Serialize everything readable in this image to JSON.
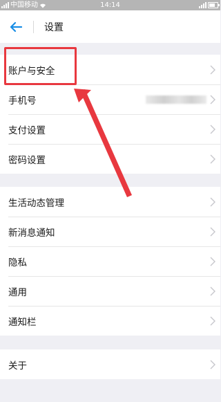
{
  "status_bar": {
    "carrier": "中国移动",
    "time": "14:14"
  },
  "header": {
    "title": "设置",
    "back_icon": "back-arrow-icon"
  },
  "groups": [
    {
      "items": [
        {
          "label": "账户与安全"
        },
        {
          "label": "手机号",
          "value_redacted": true
        },
        {
          "label": "支付设置"
        },
        {
          "label": "密码设置"
        }
      ]
    },
    {
      "items": [
        {
          "label": "生活动态管理"
        },
        {
          "label": "新消息通知"
        },
        {
          "label": "隐私"
        },
        {
          "label": "通用"
        },
        {
          "label": "通知栏"
        }
      ]
    },
    {
      "items": [
        {
          "label": "关于"
        }
      ]
    }
  ],
  "annotation": {
    "color": "#e8383f",
    "target": "账户与安全"
  },
  "colors": {
    "accent": "#1a8ee6",
    "background": "#efeff4",
    "status_bar": "#b5b5b5"
  }
}
